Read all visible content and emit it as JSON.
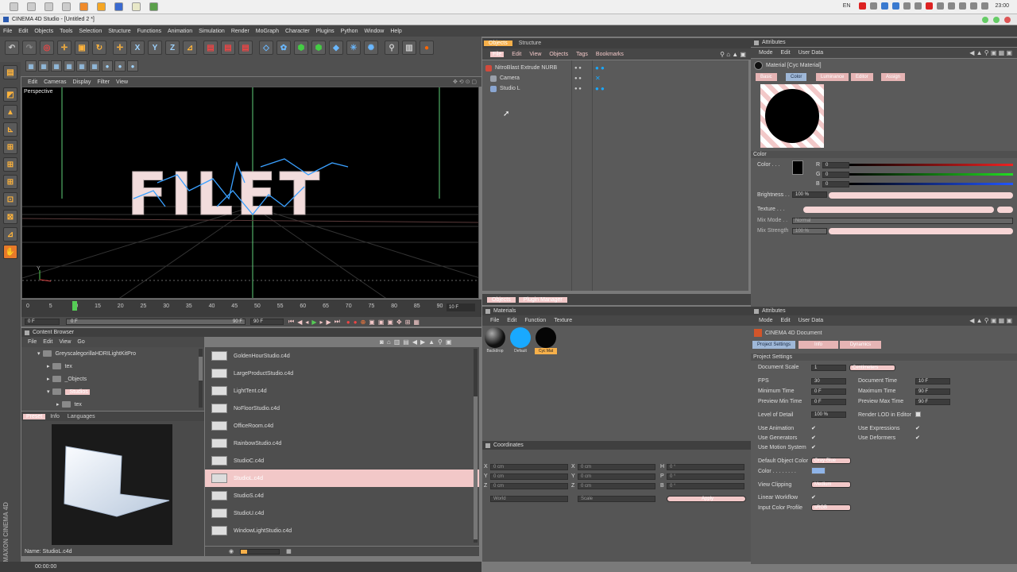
{
  "os": {
    "tray_lang": "EN",
    "clock": "23:00"
  },
  "window": {
    "title": "CINEMA 4D Studio - [Untitled 2 *]"
  },
  "menu": [
    "File",
    "Edit",
    "Objects",
    "Tools",
    "Selection",
    "Structure",
    "Functions",
    "Animation",
    "Simulation",
    "Render",
    "MoGraph",
    "Character",
    "Plugins",
    "Python",
    "Window",
    "Help"
  ],
  "viewport": {
    "menu": [
      "Edit",
      "Cameras",
      "Display",
      "Filter",
      "View"
    ],
    "camera_label": "Perspective",
    "text_object": "FILET"
  },
  "timeline": {
    "ticks": [
      "0",
      "5",
      "10",
      "15",
      "20",
      "25",
      "30",
      "35",
      "40",
      "45",
      "50",
      "55",
      "60",
      "65",
      "70",
      "75",
      "80",
      "85",
      "90"
    ],
    "end_frame": "10 F",
    "start_field": "0 F",
    "min_field": "0 F",
    "max_field": "90 F",
    "max_field2": "90 F"
  },
  "content_browser": {
    "title": "Content Browser",
    "menu": [
      "File",
      "Edit",
      "View",
      "Go"
    ],
    "tree": [
      {
        "label": "GreyscalegorillaHDRILightKitPro",
        "indent": 0
      },
      {
        "label": "tex",
        "indent": 1
      },
      {
        "label": "_Objects",
        "indent": 1
      },
      {
        "label": "_Studios",
        "indent": 1
      },
      {
        "label": "tex",
        "indent": 2
      }
    ],
    "tabs": [
      "Preset",
      "Info",
      "Languages"
    ],
    "files": [
      "GoldenHourStudio.c4d",
      "LargeProductStudio.c4d",
      "LightTent.c4d",
      "NoFloorStudio.c4d",
      "OfficeRoom.c4d",
      "RainbowStudio.c4d",
      "StudioC.c4d",
      "StudioL.c4d",
      "StudioS.c4d",
      "StudioU.c4d",
      "WindowLightStudio.c4d"
    ],
    "selected_file": "StudioL.c4d",
    "name_label": "Name: StudioL.c4d"
  },
  "status": {
    "time": "00:00:00",
    "maxon_logo": "MAXON CINEMA 4D"
  },
  "object_manager": {
    "tabs": [
      "Objects",
      "Structure"
    ],
    "menu": [
      "File",
      "Edit",
      "View",
      "Objects",
      "Tags",
      "Bookmarks"
    ],
    "objects": [
      {
        "name": "NitroBlast Extrude NURB",
        "icon_color": "#d24a3c"
      },
      {
        "name": "Camera",
        "icon_color": "#9aa0aa"
      },
      {
        "name": "Studio L",
        "icon_color": "#8aa6d2"
      }
    ],
    "bottom_tabs": [
      "Objects",
      "Plugin Manager"
    ]
  },
  "materials": {
    "title": "Materials",
    "menu": [
      "File",
      "Edit",
      "Function",
      "Texture"
    ],
    "items": [
      {
        "label": "Backdrop",
        "color": "#111111"
      },
      {
        "label": "Default",
        "color": "#19a9ff"
      },
      {
        "label": "Cyc Mat",
        "color": "#050505"
      }
    ]
  },
  "coordinates": {
    "title": "Coordinates",
    "rows": [
      {
        "a": "X",
        "av": "0 cm",
        "b": "X",
        "bv": "0 cm",
        "c": "H",
        "cv": "0 °"
      },
      {
        "a": "Y",
        "av": "0 cm",
        "b": "Y",
        "bv": "0 cm",
        "c": "P",
        "cv": "0 °"
      },
      {
        "a": "Z",
        "av": "0 cm",
        "b": "Z",
        "bv": "0 cm",
        "c": "B",
        "cv": "0 °"
      }
    ],
    "mode1": "World",
    "mode2": "Scale",
    "apply": "Apply"
  },
  "attributes_material": {
    "title": "Attributes",
    "menu": [
      "Mode",
      "Edit",
      "User Data"
    ],
    "material_name": "Material [Cyc Material]",
    "tabs": [
      "Basic",
      "Color",
      "Luminance",
      "Editor",
      "Assign"
    ],
    "section": "Color",
    "color_label": "Color",
    "r": "0",
    "g": "0",
    "b": "0",
    "brightness_label": "Brightness",
    "brightness": "100 %",
    "texture_label": "Texture",
    "mix_mode_label": "Mix Mode",
    "mix_mode": "Normal",
    "mix_strength_label": "Mix Strength",
    "mix_strength": "100 %",
    "r_label": "R",
    "g_label": "G",
    "b_label": "B"
  },
  "attributes_project": {
    "title": "Attributes",
    "menu": [
      "Mode",
      "Edit",
      "User Data"
    ],
    "doc_name": "CINEMA 4D Document",
    "tabs": [
      "Project Settings",
      "Info",
      "Dynamics"
    ],
    "section": "Project Settings",
    "document_scale_label": "Document Scale",
    "document_scale": "1",
    "document_scale_unit": "Centimeters",
    "fps_label": "FPS",
    "fps": "30",
    "doc_time_label": "Document Time",
    "doc_time": "10 F",
    "min_time_label": "Minimum Time",
    "min_time": "0 F",
    "max_time_label": "Maximum Time",
    "max_time": "90 F",
    "prev_min_label": "Preview Min Time",
    "prev_min": "0 F",
    "prev_max_label": "Preview Max Time",
    "prev_max": "90 F",
    "lod_label": "Level of Detail",
    "lod": "100 %",
    "render_lod_label": "Render LOD in Editor",
    "use_anim_label": "Use Animation",
    "use_expr_label": "Use Expressions",
    "use_gen_label": "Use Generators",
    "use_def_label": "Use Deformers",
    "use_motion_label": "Use Motion System",
    "def_obj_color_label": "Default Object Color",
    "def_obj_color": "Gray-Blue",
    "color_label": "Color",
    "view_clipping_label": "View Clipping",
    "view_clipping": "Medium",
    "linear_wf_label": "Linear Workflow",
    "input_cp_label": "Input Color Profile",
    "input_cp": "sRGB"
  },
  "colors": {
    "accent_orange": "#ffb43c",
    "selection_pink": "#f2c8c8",
    "panel_bg": "#5a5a5a"
  }
}
